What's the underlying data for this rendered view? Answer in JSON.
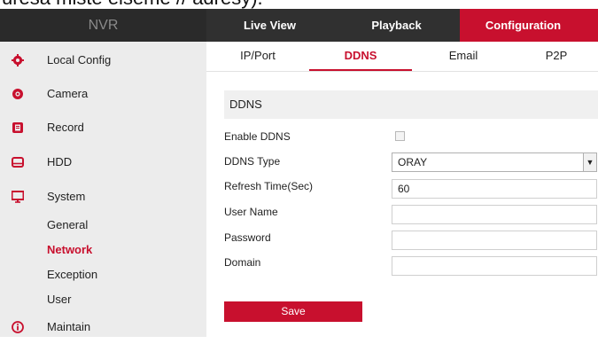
{
  "caption": "uresa mistë elsemë // adresy).",
  "header": {
    "brand": "NVR",
    "nav": [
      "Live View",
      "Playback",
      "Configuration"
    ],
    "active_color": "#c8102e"
  },
  "sidebar": {
    "items": [
      {
        "label": "Local Config",
        "icon": "gear-icon"
      },
      {
        "label": "Camera",
        "icon": "camera-icon"
      },
      {
        "label": "Record",
        "icon": "record-icon"
      },
      {
        "label": "HDD",
        "icon": "hdd-icon"
      },
      {
        "label": "System",
        "icon": "monitor-icon"
      },
      {
        "label": "Maintain",
        "icon": "info-icon"
      }
    ],
    "subitems": [
      "General",
      "Network",
      "Exception",
      "User"
    ],
    "active_subitem": "Network"
  },
  "tabs": [
    "IP/Port",
    "DDNS",
    "Email",
    "P2P"
  ],
  "active_tab": "DDNS",
  "form": {
    "section_title": "DDNS",
    "enable_label": "Enable DDNS",
    "enable_checked": false,
    "type_label": "DDNS Type",
    "type_value": "ORAY",
    "refresh_label": "Refresh Time(Sec)",
    "refresh_value": "60",
    "username_label": "User Name",
    "username_value": "",
    "password_label": "Password",
    "password_value": "",
    "domain_label": "Domain",
    "domain_value": "",
    "save_label": "Save"
  }
}
